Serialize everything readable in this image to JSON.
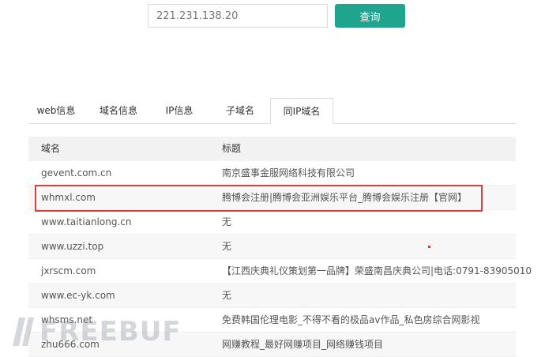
{
  "search": {
    "value": "221.231.138.20",
    "button_label": "查询"
  },
  "tabs": [
    {
      "label": "web信息",
      "active": false
    },
    {
      "label": "域名信息",
      "active": false
    },
    {
      "label": "IP信息",
      "active": false
    },
    {
      "label": "子域名",
      "active": false
    },
    {
      "label": "同IP域名",
      "active": true
    }
  ],
  "table": {
    "headers": {
      "domain": "域名",
      "title": "标题"
    },
    "rows": [
      {
        "domain": "gevent.com.cn",
        "title": "南京盛事金服网络科技有限公司"
      },
      {
        "domain": "whmxl.com",
        "title": "腾博会注册|腾博会亚洲娱乐平台_腾博会娱乐注册【官网】"
      },
      {
        "domain": "www.taitianlong.cn",
        "title": "无"
      },
      {
        "domain": "www.uzzi.top",
        "title": "无"
      },
      {
        "domain": "jxrscm.com",
        "title": "【江西庆典礼仪策划第一品牌】荣盛南昌庆典公司|电话:0791-83905010"
      },
      {
        "domain": "www.ec-yk.com",
        "title": "无"
      },
      {
        "domain": "whsms.net",
        "title": "免费韩国伦理电影_不得不看的极品av作品_私色房综合网影视"
      },
      {
        "domain": "zhu666.com",
        "title": "网赚教程_最好网赚项目_网络赚钱项目"
      }
    ]
  },
  "watermark": {
    "text": "FREEBUF"
  },
  "colors": {
    "accent": "#1fa58d",
    "highlight": "#d94141"
  }
}
